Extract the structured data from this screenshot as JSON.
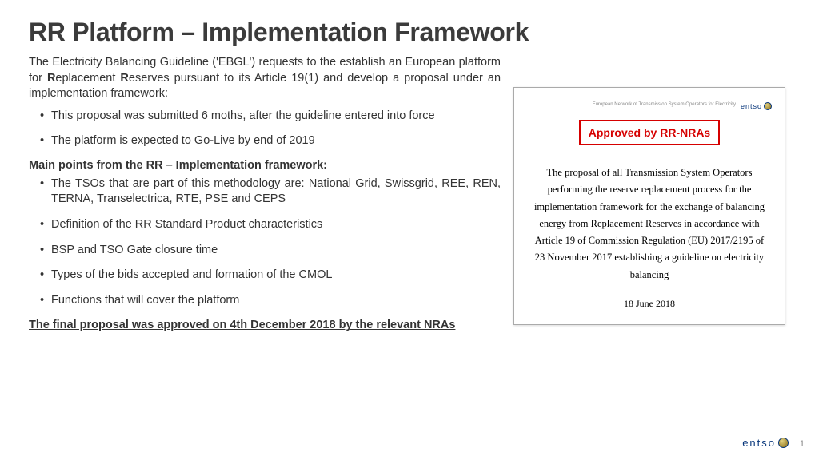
{
  "title": "RR Platform – Implementation Framework",
  "intro": {
    "pre": "The Electricity Balancing Guideline ('EBGL') requests to the establish an European platform for ",
    "b1": "R",
    "mid1": "eplacement ",
    "b2": "R",
    "post": "eserves pursuant to its Article 19(1) and develop a proposal under an implementation framework:"
  },
  "bullets1": [
    "This proposal was submitted 6 moths, after the guideline entered into force",
    "The platform is expected to Go-Live by end of 2019"
  ],
  "subhead": "Main points from the RR – Implementation framework:",
  "bullets2": [
    "The TSOs that are part of this methodology are: National Grid, Swissgrid, REE, REN, TERNA, Transelectrica, RTE, PSE and CEPS",
    "Definition of the RR Standard Product characteristics",
    "BSP and TSO Gate closure time",
    "Types of the bids accepted and formation of the CMOL",
    "Functions that will cover the platform"
  ],
  "final_note": "The final proposal was approved on 4th December 2018 by the relevant NRAs",
  "doc": {
    "header_text": "European Network of\nTransmission System Operators\nfor Electricity",
    "approved": "Approved by RR-NRAs",
    "body": "The proposal of all Transmission System Operators performing the reserve replacement process for the implementation framework for the exchange of balancing energy from Replacement Reserves in accordance with Article 19 of Commission Regulation (EU) 2017/2195 of 23 November 2017 establishing a guideline on electricity balancing",
    "date": "18 June 2018",
    "logo_text": "entso"
  },
  "footer": {
    "logo_text": "entso",
    "page": "1"
  }
}
